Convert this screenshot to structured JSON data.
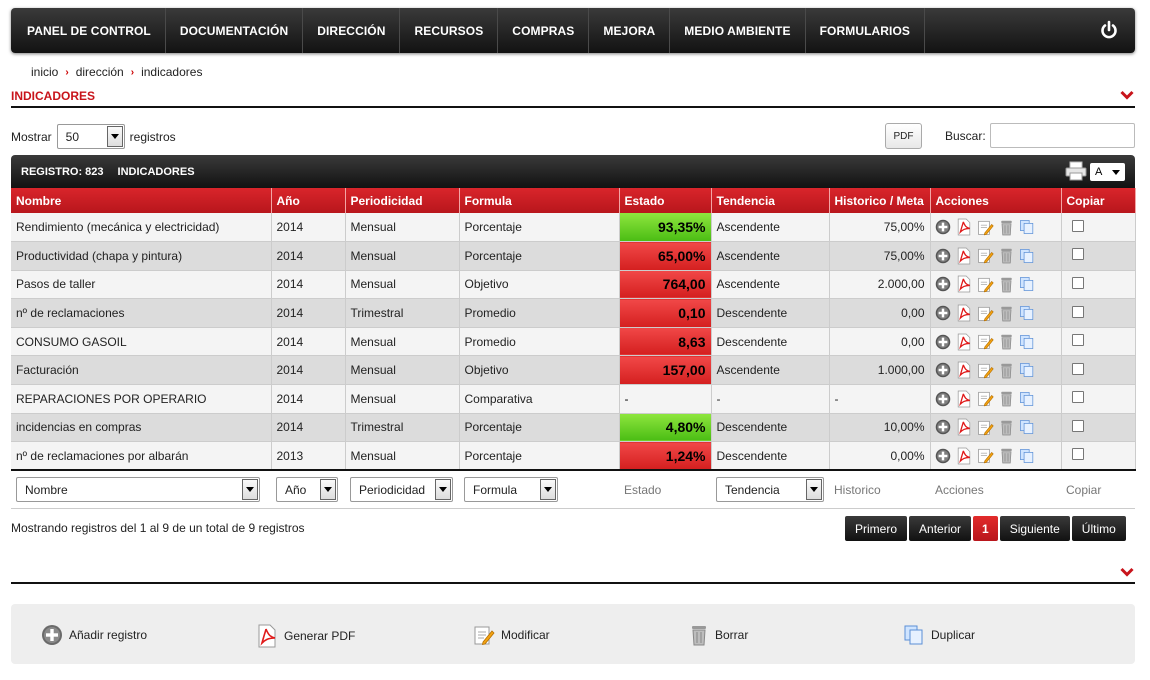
{
  "nav": {
    "items": [
      "PANEL DE CONTROL",
      "DOCUMENTACIÓN",
      "DIRECCIÓN",
      "RECURSOS",
      "COMPRAS",
      "MEJORA",
      "MEDIO AMBIENTE",
      "FORMULARIOS"
    ]
  },
  "breadcrumb": [
    "inicio",
    "dirección",
    "indicadores"
  ],
  "section": {
    "title": "INDICADORES"
  },
  "controls": {
    "show_label": "Mostrar",
    "show_value": "50",
    "records_label": "registros",
    "pdf_label": "PDF",
    "search_label": "Buscar:",
    "search_value": ""
  },
  "table_bar": {
    "registro": "REGISTRO: 823",
    "name": "INDICADORES",
    "font_value": "A"
  },
  "columns": [
    "Nombre",
    "Año",
    "Periodicidad",
    "Formula",
    "Estado",
    "Tendencia",
    "Historico / Meta",
    "Acciones",
    "Copiar"
  ],
  "rows": [
    {
      "nombre": "Rendimiento (mecánica y electricidad)",
      "anio": "2014",
      "periodicidad": "Mensual",
      "formula": "Porcentaje",
      "estado": "93,35%",
      "estado_color": "green",
      "tendencia": "Ascendente",
      "historico": "75,00%"
    },
    {
      "nombre": "Productividad (chapa y pintura)",
      "anio": "2014",
      "periodicidad": "Mensual",
      "formula": "Porcentaje",
      "estado": "65,00%",
      "estado_color": "red",
      "tendencia": "Ascendente",
      "historico": "75,00%"
    },
    {
      "nombre": "Pasos de taller",
      "anio": "2014",
      "periodicidad": "Mensual",
      "formula": "Objetivo",
      "estado": "764,00",
      "estado_color": "red",
      "tendencia": "Ascendente",
      "historico": "2.000,00"
    },
    {
      "nombre": "nº de reclamaciones",
      "anio": "2014",
      "periodicidad": "Trimestral",
      "formula": "Promedio",
      "estado": "0,10",
      "estado_color": "red",
      "tendencia": "Descendente",
      "historico": "0,00"
    },
    {
      "nombre": "CONSUMO GASOIL",
      "anio": "2014",
      "periodicidad": "Mensual",
      "formula": "Promedio",
      "estado": "8,63",
      "estado_color": "red",
      "tendencia": "Descendente",
      "historico": "0,00"
    },
    {
      "nombre": "Facturación",
      "anio": "2014",
      "periodicidad": "Mensual",
      "formula": "Objetivo",
      "estado": "157,00",
      "estado_color": "red",
      "tendencia": "Ascendente",
      "historico": "1.000,00"
    },
    {
      "nombre": "REPARACIONES POR OPERARIO",
      "anio": "2014",
      "periodicidad": "Mensual",
      "formula": "Comparativa",
      "estado": "-",
      "estado_color": "none",
      "tendencia": "-",
      "historico": "-"
    },
    {
      "nombre": "incidencias en compras",
      "anio": "2014",
      "periodicidad": "Trimestral",
      "formula": "Porcentaje",
      "estado": "4,80%",
      "estado_color": "green",
      "tendencia": "Descendente",
      "historico": "10,00%"
    },
    {
      "nombre": "nº de reclamaciones por albarán",
      "anio": "2013",
      "periodicidad": "Mensual",
      "formula": "Porcentaje",
      "estado": "1,24%",
      "estado_color": "red",
      "tendencia": "Descendente",
      "historico": "0,00%"
    }
  ],
  "filters": {
    "nombre": "Nombre",
    "anio": "Año",
    "periodicidad": "Periodicidad",
    "formula": "Formula",
    "estado": "Estado",
    "tendencia": "Tendencia",
    "historico": "Historico",
    "acciones": "Acciones",
    "copiar": "Copiar"
  },
  "info": "Mostrando registros del 1 al 9 de un total de 9 registros",
  "pager": {
    "first": "Primero",
    "prev": "Anterior",
    "current": "1",
    "next": "Siguiente",
    "last": "Último"
  },
  "bottom_actions": {
    "add": "Añadir registro",
    "pdf": "Generar PDF",
    "edit": "Modificar",
    "delete": "Borrar",
    "duplicate": "Duplicar"
  },
  "colors": {
    "accent": "#c8141b",
    "estado_red": "#e23030",
    "estado_green": "#6fd22a"
  }
}
